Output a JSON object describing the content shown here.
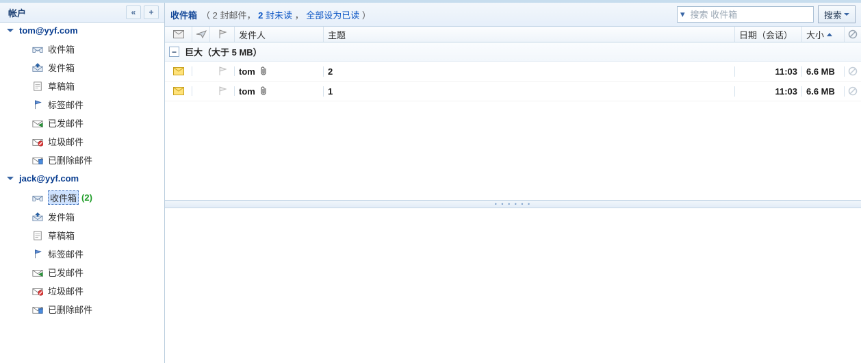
{
  "sidebar": {
    "title": "帐户",
    "accounts": [
      {
        "name": "tom@yyf.com",
        "folders": [
          {
            "label": "收件箱",
            "icon": "inbox"
          },
          {
            "label": "发件箱",
            "icon": "outbox"
          },
          {
            "label": "草稿箱",
            "icon": "drafts"
          },
          {
            "label": "标签邮件",
            "icon": "flag"
          },
          {
            "label": "已发邮件",
            "icon": "sent"
          },
          {
            "label": "垃圾邮件",
            "icon": "junk"
          },
          {
            "label": "已删除邮件",
            "icon": "trash"
          }
        ]
      },
      {
        "name": "jack@yyf.com",
        "folders": [
          {
            "label": "收件箱",
            "icon": "inbox",
            "selected": true,
            "count": "(2)"
          },
          {
            "label": "发件箱",
            "icon": "outbox"
          },
          {
            "label": "草稿箱",
            "icon": "drafts"
          },
          {
            "label": "标签邮件",
            "icon": "flag"
          },
          {
            "label": "已发邮件",
            "icon": "sent"
          },
          {
            "label": "垃圾邮件",
            "icon": "junk"
          },
          {
            "label": "已删除邮件",
            "icon": "trash"
          }
        ]
      }
    ]
  },
  "toolbar": {
    "title": "收件箱",
    "info_open": "（",
    "info_total": "2 封邮件，",
    "info_unread_count": "2",
    "info_unread_text": " 封未读",
    "info_sep": "，",
    "info_markall": "全部设为已读",
    "info_close": "）",
    "search_placeholder": "搜索 收件箱",
    "search_button": "搜索"
  },
  "columns": {
    "sender": "发件人",
    "subject": "主题",
    "date": "日期（会话）",
    "size": "大小"
  },
  "list": {
    "group_label": "巨大（大于 5 MB）",
    "messages": [
      {
        "sender": "tom",
        "has_attach": true,
        "subject": "2",
        "date": "11:03",
        "size": "6.6 MB"
      },
      {
        "sender": "tom",
        "has_attach": true,
        "subject": "1",
        "date": "11:03",
        "size": "6.6 MB"
      }
    ]
  }
}
